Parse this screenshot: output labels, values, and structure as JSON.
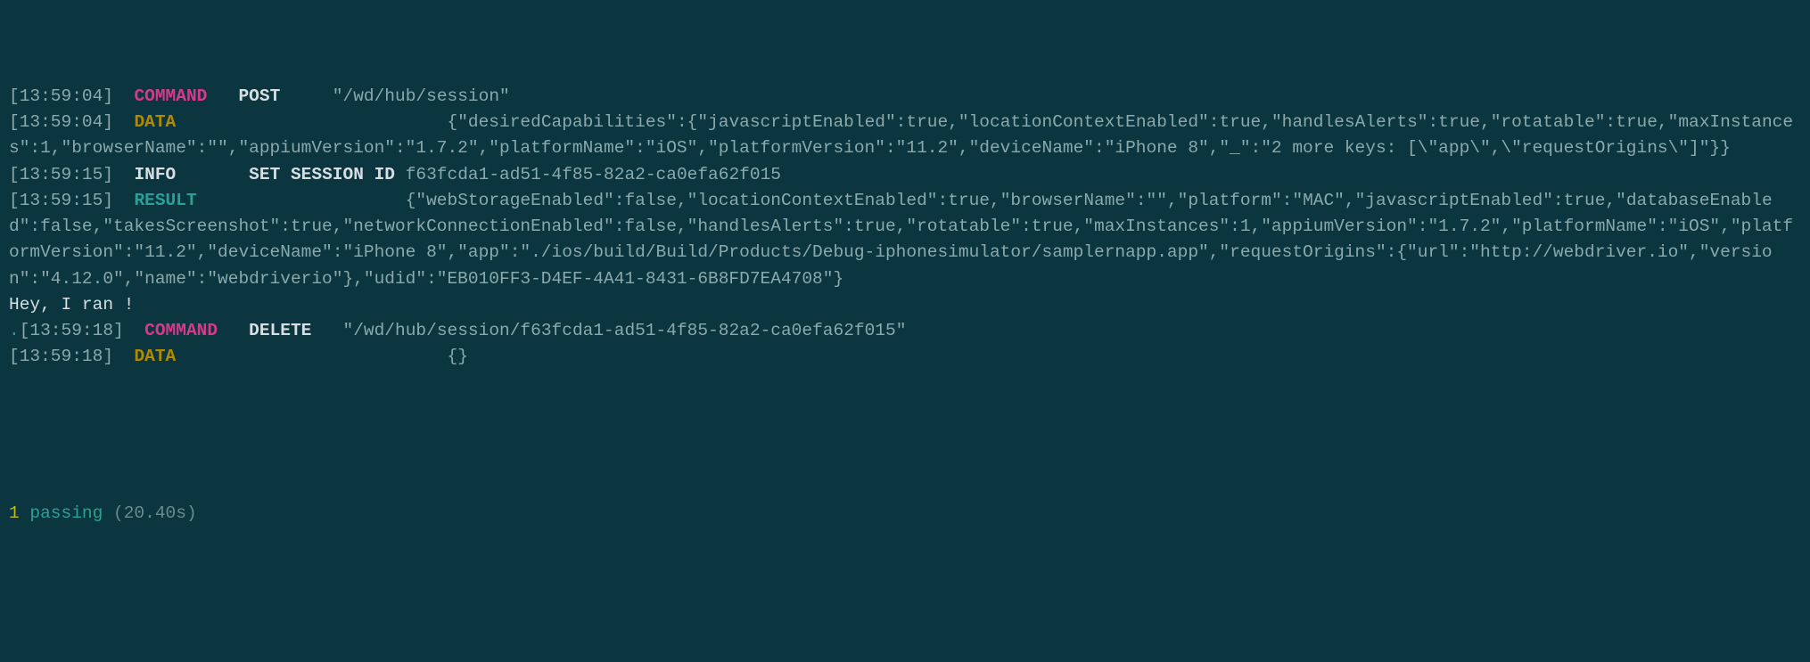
{
  "lines": [
    {
      "ts": "[13:59:04]",
      "label": "COMMAND",
      "labelClass": "label-command",
      "verb": "POST",
      "gapAfterLabel": "   ",
      "gapAfterVerb": "     ",
      "payload": "\"/wd/hub/session\""
    },
    {
      "ts": "[13:59:04]",
      "label": "DATA",
      "labelClass": "label-data",
      "gapAfterLabel": "                          ",
      "payload": "{\"desiredCapabilities\":{\"javascriptEnabled\":true,\"locationContextEnabled\":true,\"handlesAlerts\":true,\"rotatable\":true,\"maxInstances\":1,\"browserName\":\"\",\"appiumVersion\":\"1.7.2\",\"platformName\":\"iOS\",\"platformVersion\":\"11.2\",\"deviceName\":\"iPhone 8\",\"_\":\"2 more keys: [\\\"app\\\",\\\"requestOrigins\\\"]\"}}"
    },
    {
      "ts": "[13:59:15]",
      "label": "INFO",
      "labelClass": "label-info",
      "gapAfterLabel": "       ",
      "verb": "SET SESSION ID",
      "gapAfterVerb": " ",
      "payload": "f63fcda1-ad51-4f85-82a2-ca0efa62f015"
    },
    {
      "ts": "[13:59:15]",
      "label": "RESULT",
      "labelClass": "label-result",
      "gapAfterLabel": "                    ",
      "payload": "{\"webStorageEnabled\":false,\"locationContextEnabled\":true,\"browserName\":\"\",\"platform\":\"MAC\",\"javascriptEnabled\":true,\"databaseEnabled\":false,\"takesScreenshot\":true,\"networkConnectionEnabled\":false,\"handlesAlerts\":true,\"rotatable\":true,\"maxInstances\":1,\"appiumVersion\":\"1.7.2\",\"platformName\":\"iOS\",\"platformVersion\":\"11.2\",\"deviceName\":\"iPhone 8\",\"app\":\"./ios/build/Build/Products/Debug-iphonesimulator/samplernapp.app\",\"requestOrigins\":{\"url\":\"http://webdriver.io\",\"version\":\"4.12.0\",\"name\":\"webdriverio\"},\"udid\":\"EB010FF3-D4EF-4A41-8431-6B8FD7EA4708\"}"
    },
    {
      "plain": "Hey, I ran !"
    },
    {
      "dot": ".",
      "ts": "[13:59:18]",
      "label": "COMMAND",
      "labelClass": "label-command",
      "verb": "DELETE",
      "gapAfterLabel": "   ",
      "gapAfterVerb": "   ",
      "payload": "\"/wd/hub/session/f63fcda1-ad51-4f85-82a2-ca0efa62f015\""
    },
    {
      "ts": "[13:59:18]",
      "label": "DATA",
      "labelClass": "label-data",
      "gapAfterLabel": "                          ",
      "payload": "{}"
    }
  ],
  "summary": {
    "count": "1",
    "word": "passing",
    "time": "(20.40s)"
  }
}
